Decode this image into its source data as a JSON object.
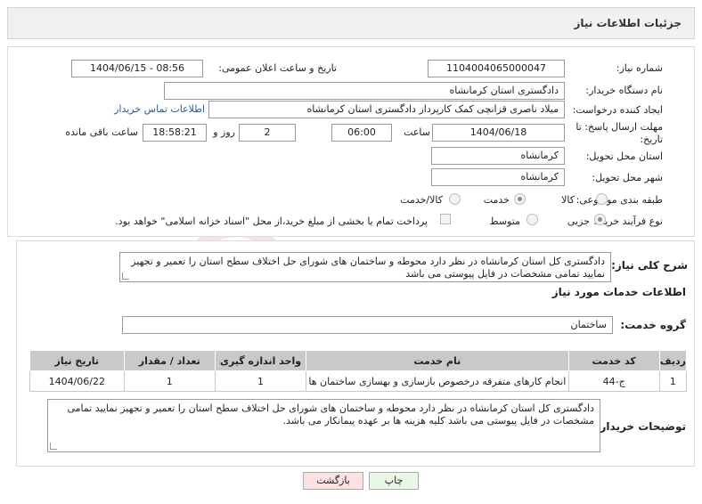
{
  "header": {
    "title": "جزئیات اطلاعات نیاز"
  },
  "form": {
    "need_number_label": "شماره نیاز:",
    "need_number": "1104004065000047",
    "announce_label": "تاریخ و ساعت اعلان عمومی:",
    "announce_value": "1404/06/15 - 08:56",
    "buyer_org_label": "نام دستگاه خریدار:",
    "buyer_org": "دادگستری استان کرمانشاه",
    "requester_label": "ایجاد کننده درخواست:",
    "requester": "میلاد ناصری قزانچی کمک کارپرداز دادگستری استان کرمانشاه",
    "contact_link": "اطلاعات تماس خریدار",
    "deadline_label_line1": "مهلت ارسال پاسخ: تا",
    "deadline_label_line2": "تاریخ:",
    "deadline_date": "1404/06/18",
    "time_label": "ساعت",
    "deadline_time": "06:00",
    "days_value": "2",
    "days_label": "روز و",
    "remaining_value": "18:58:21",
    "remaining_label": "ساعت باقی مانده",
    "province_label": "استان محل تحویل:",
    "province": "کرمانشاه",
    "city_label": "شهر محل تحویل:",
    "city": "کرمانشاه",
    "category_label": "طبقه بندی موضوعی:",
    "category_options": [
      "کالا",
      "خدمت",
      "کالا/خدمت"
    ],
    "category_selected": "خدمت",
    "process_label": "نوع فرآیند خرید :",
    "process_options": [
      "جزیی",
      "متوسط"
    ],
    "process_selected": "جزیی",
    "payment_note": "پرداخت تمام یا بخشی از مبلغ خرید،از محل \"اسناد خزانه اسلامی\" خواهد بود."
  },
  "details": {
    "summary_label": "شرح کلی نیاز:",
    "summary_text": "دادگستری کل استان کرمانشاه در نظر دارد محوطه  و ساختمان های شورای  حل اختلاف سطح استان  را تعمیر و تجهیز نمایید تمامی مشخصات در فایل پیوستی می باشد",
    "services_title": "اطلاعات خدمات مورد نیاز",
    "service_group_label": "گروه خدمت:",
    "service_group": "ساختمان",
    "table": {
      "headers": [
        "ردیف",
        "کد خدمت",
        "نام خدمت",
        "واحد اندازه گیری",
        "تعداد / مقدار",
        "تاریخ نیاز"
      ],
      "rows": [
        [
          "1",
          "ج-44",
          "انجام کارهای متفرقه درخصوص بازسازی و بهسازی ساختمان ها",
          "1",
          "1",
          "1404/06/22"
        ]
      ]
    },
    "buyer_notes_label": "توضیحات خریدار:",
    "buyer_notes": "دادگستری کل استان کرمانشاه در نظر دارد محوطه  و ساختمان های شورای  حل اختلاف سطح استان  را تعمیر و تجهیز نمایید تمامی مشخصات در فایل پیوستی می باشد کلیه هزینه ها بر عهده پیمانکار می باشد."
  },
  "buttons": {
    "print": "چاپ",
    "back": "بازگشت"
  },
  "colors": {
    "back_button_bg": "#fbe1e1",
    "print_button_bg": "#eaf7e6",
    "table_header_bg": "#c9c9c9",
    "link": "#1f5ea8"
  }
}
